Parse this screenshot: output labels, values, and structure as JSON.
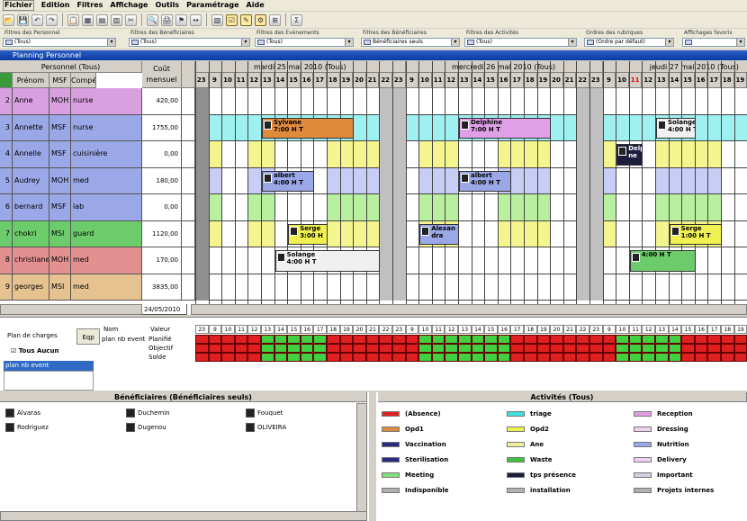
{
  "menu": [
    "Fichier",
    "Edition",
    "Filtres",
    "Affichage",
    "Outils",
    "Paramétrage",
    "Aide"
  ],
  "filters": [
    {
      "label": "Filtres des Personnel",
      "value": "(Tous)"
    },
    {
      "label": "Filtres des Bénéficiaires",
      "value": "(Tous)"
    },
    {
      "label": "Filtres des Evénements",
      "value": "(Tous)"
    },
    {
      "label": "Filtres des Bénéficiaires",
      "value": "Bénéficiaires seuls"
    },
    {
      "label": "Filtres des Activités",
      "value": "(Tous)"
    },
    {
      "label": "Ordres des rubriques",
      "value": "(Ordre par défaut)"
    },
    {
      "label": "Affichages favoris",
      "value": ""
    }
  ],
  "window_title": "Planning Personnel",
  "grid": {
    "personnel_header": "Personnel (Tous)",
    "cols": [
      "Prénom",
      "MSF",
      "Compétences"
    ],
    "cost_header": [
      "Coût",
      "mensuel"
    ],
    "days": [
      "mardi 25 mai 2010 (Tous)",
      "mercredi 26 mai 2010 (Tous)",
      "jeudi 27 mai 2010 (Tous)"
    ],
    "hours": [
      "23",
      "9",
      "10",
      "11",
      "12",
      "13",
      "14",
      "15",
      "16",
      "17",
      "18",
      "19",
      "20",
      "21",
      "22",
      "23",
      "9",
      "10",
      "11",
      "12",
      "13",
      "14",
      "15",
      "16",
      "17",
      "18",
      "19",
      "20",
      "21",
      "22",
      "23",
      "9",
      "10",
      "11",
      "12",
      "13",
      "14",
      "15",
      "16",
      "17",
      "18",
      "19"
    ],
    "rows": [
      {
        "num": "2",
        "name": "Anne",
        "msf": "MOH",
        "comp": "nurse",
        "cost": "420,00",
        "color": "#d9a0e0"
      },
      {
        "num": "3",
        "name": "Annette",
        "msf": "MSF",
        "comp": "nurse",
        "cost": "1755,00",
        "color": "#9aa8e8"
      },
      {
        "num": "4",
        "name": "Annelle",
        "msf": "MSF",
        "comp": "cuisinière",
        "cost": "0,00",
        "color": "#9aa8e8"
      },
      {
        "num": "5",
        "name": "Audrey",
        "msf": "MOH",
        "comp": "med",
        "cost": "180,00",
        "color": "#9aa8e8"
      },
      {
        "num": "6",
        "name": "bernard",
        "msf": "MSF",
        "comp": "lab",
        "cost": "0,00",
        "color": "#9aa8e8"
      },
      {
        "num": "7",
        "name": "chokri",
        "msf": "MSI",
        "comp": "guard",
        "cost": "1120,00",
        "color": "#6ccc6c"
      },
      {
        "num": "8",
        "name": "christiane",
        "msf": "MOH",
        "comp": "med",
        "cost": "170,00",
        "color": "#e39090"
      },
      {
        "num": "9",
        "name": "georges",
        "msf": "MSI",
        "comp": "med",
        "cost": "3835,00",
        "color": "#e6c290"
      }
    ],
    "date_field": "24/05/2010",
    "events": [
      {
        "name": "Sylvane",
        "time": "7:00 H T",
        "color": "#e08a3c"
      },
      {
        "name": "Delphine",
        "time": "7:00 H T",
        "color": "#e0a0e8"
      },
      {
        "name": "Solange",
        "time": "4:00 H T",
        "color": "#f0f0f0"
      },
      {
        "name": "Delphi",
        "time": "ne",
        "color": "#1c1c3c"
      },
      {
        "name": "albert",
        "time": "4:00 H T",
        "color": "#9aa8e8"
      },
      {
        "name": "albert",
        "time": "4:00 H T",
        "color": "#9aa8e8"
      },
      {
        "name": "Serge",
        "time": "3:00 H",
        "color": "#f0f050"
      },
      {
        "name": "Alexan",
        "time": "dra",
        "color": "#9aa8e8"
      },
      {
        "name": "Serge",
        "time": "1:00 H T",
        "color": "#f0f050"
      },
      {
        "name": "Solange",
        "time": "4:00 H T",
        "color": "#f0f0f0"
      },
      {
        "name": "",
        "time": "4:00 H T",
        "color": "#6ccc6c"
      }
    ]
  },
  "summary": {
    "plan_label": "Plan de charges",
    "tab_label": "Eqp",
    "check_label": "Tous Aucun",
    "list_item": "plan nb event",
    "cols": [
      "Nom",
      "Valeur"
    ],
    "name_cell": "plan nb event",
    "value_rows": [
      "Planifié",
      "Objectif",
      "Solde"
    ]
  },
  "benef": {
    "title": "Bénéficiaires (Bénéficiaires seuls)",
    "items": [
      "Alvaras",
      "Duchemin",
      "Fouquet",
      "Rodriguez",
      "Dugenou",
      "OLIVEIRA"
    ]
  },
  "activities": {
    "title": "Activités (Tous)",
    "items": [
      {
        "label": "(Absence)",
        "color": "#e02020"
      },
      {
        "label": "triage",
        "color": "#40e0e0"
      },
      {
        "label": "Reception",
        "color": "#e0a0e0"
      },
      {
        "label": "Opd1",
        "color": "#e08a3c"
      },
      {
        "label": "Opd2",
        "color": "#f0f050"
      },
      {
        "label": "Dressing",
        "color": "#f0d0f0"
      },
      {
        "label": "Vaccination",
        "color": "#2a2a80"
      },
      {
        "label": "Ane",
        "color": "#f0f0a0"
      },
      {
        "label": "Nutrition",
        "color": "#9aa8e8"
      },
      {
        "label": "Sterilisation",
        "color": "#2a2a80"
      },
      {
        "label": "Waste",
        "color": "#40c040"
      },
      {
        "label": "Delivery",
        "color": "#f0d0f0"
      },
      {
        "label": "Meeting",
        "color": "#80e080"
      },
      {
        "label": "tps présence",
        "color": "#1c1c3c"
      },
      {
        "label": "Important",
        "color": "#d0d0e0"
      },
      {
        "label": "Indisponible",
        "color": "#b0b0b0"
      },
      {
        "label": "installation",
        "color": "#b0b0b0"
      },
      {
        "label": "Projets internes",
        "color": "#b0b0b0"
      }
    ]
  }
}
